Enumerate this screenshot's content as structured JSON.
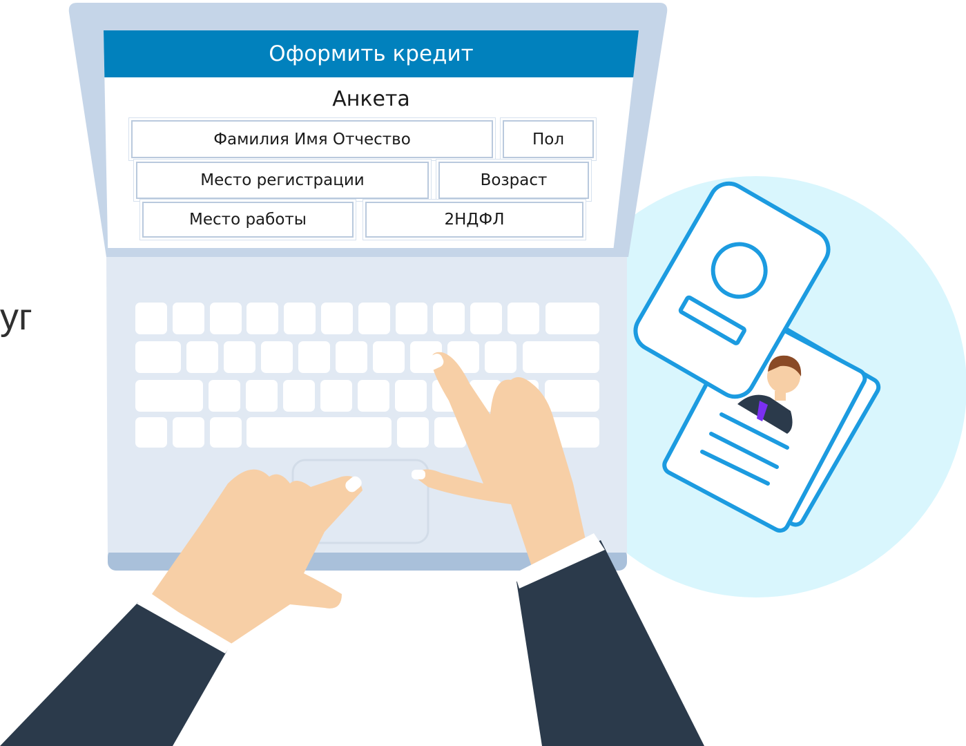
{
  "partial_left_text": "уг",
  "form": {
    "header": "Оформить кредит",
    "title": "Анкета",
    "fields": {
      "full_name": "Фамилия Имя Отчество",
      "gender": "Пол",
      "registration": "Место регистрации",
      "age": "Возраст",
      "workplace": "Место работы",
      "income_cert": "2НДФЛ"
    }
  },
  "colors": {
    "header_blue": "#0181bd",
    "laptop_frame": "#c5d5e8",
    "laptop_base": "#e1e9f3",
    "skin": "#f7cfa6",
    "sleeve": "#2b3a4b",
    "circle": "#d9f6fd",
    "doc_stroke": "#1c9be0"
  }
}
